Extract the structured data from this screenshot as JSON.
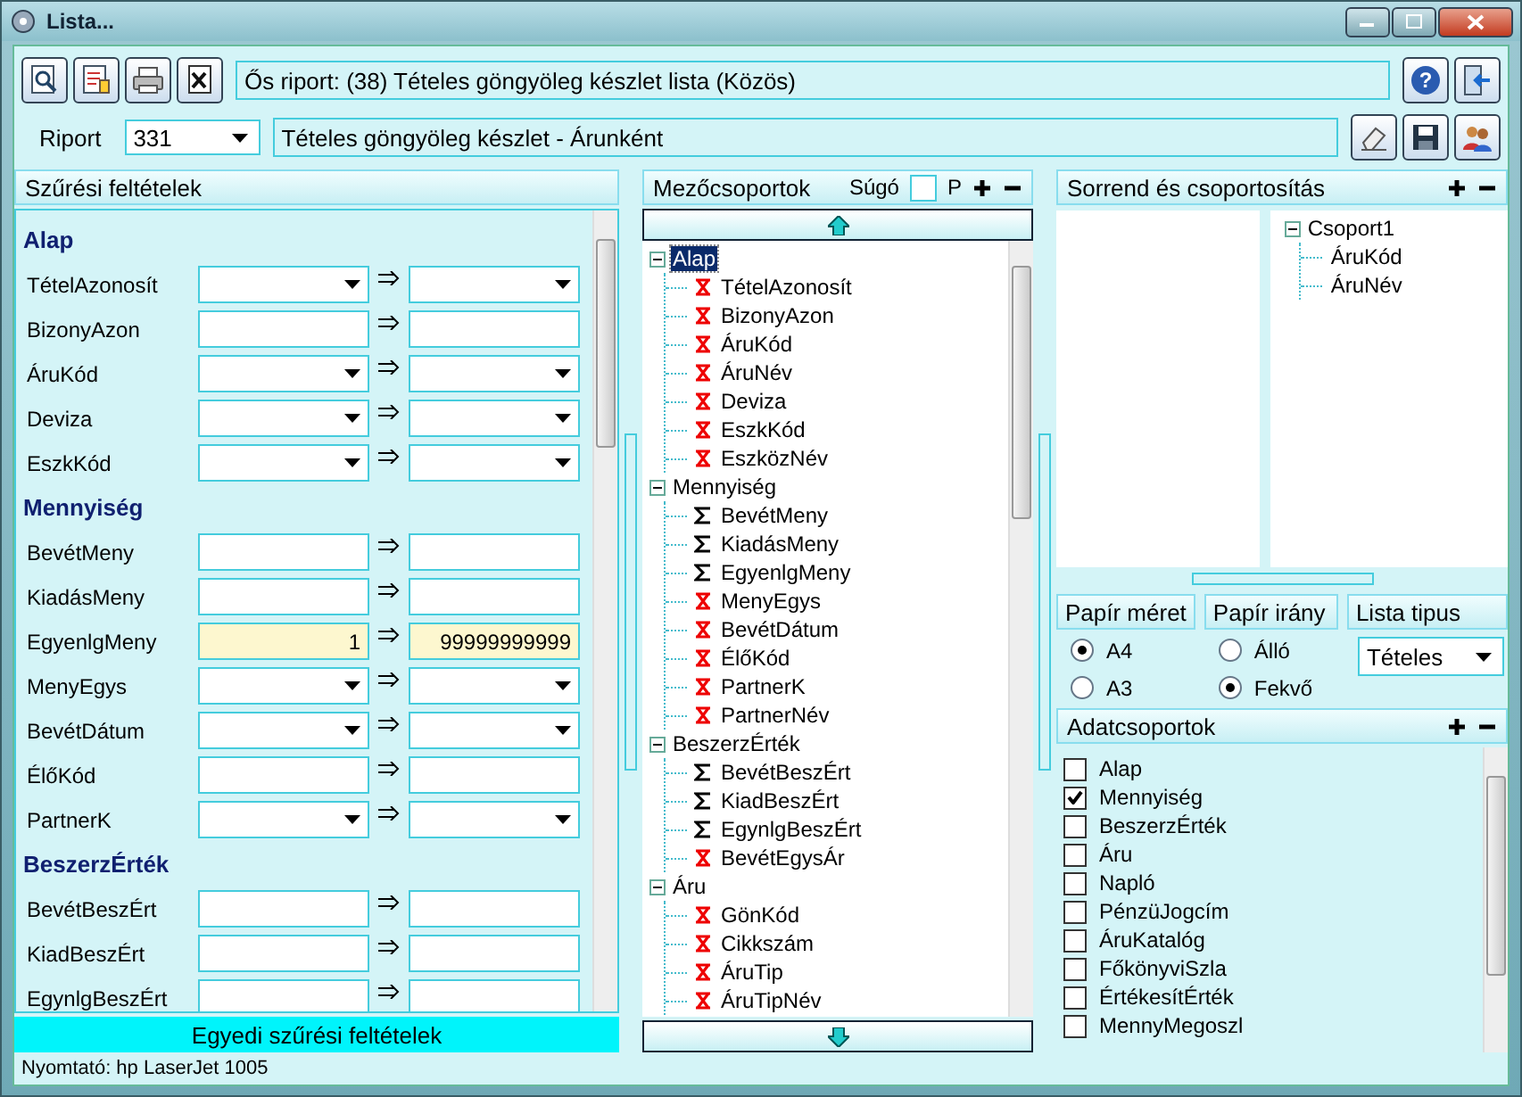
{
  "window": {
    "title": "Lista..."
  },
  "toolbar": {
    "help_button": "?",
    "parent_report": "Ős riport: (38)  Tételes göngyöleg készlet lista (Közös)"
  },
  "report": {
    "label": "Riport",
    "number": "331",
    "name": "Tételes göngyöleg készlet - Árunként"
  },
  "filters": {
    "title": "Szűrési feltételek",
    "groups": [
      {
        "name": "Alap",
        "rows": [
          {
            "label": "TételAzonosít",
            "kind": "combo",
            "highlighted": false
          },
          {
            "label": "BizonyAzon",
            "kind": "text",
            "highlighted": false
          },
          {
            "label": "ÁruKód",
            "kind": "combo",
            "highlighted": false
          },
          {
            "label": "Deviza",
            "kind": "combo",
            "highlighted": false
          },
          {
            "label": "EszkKód",
            "kind": "combo",
            "highlighted": false
          }
        ]
      },
      {
        "name": "Mennyiség",
        "rows": [
          {
            "label": "BevétMeny",
            "kind": "text",
            "highlighted": false
          },
          {
            "label": "KiadásMeny",
            "kind": "text",
            "highlighted": false
          },
          {
            "label": "EgyenlgMeny",
            "kind": "text",
            "highlighted": true,
            "from": "1",
            "to": "99999999999"
          },
          {
            "label": "MenyEgys",
            "kind": "combo",
            "highlighted": false
          },
          {
            "label": "BevétDátum",
            "kind": "combo",
            "highlighted": false
          },
          {
            "label": "ÉlőKód",
            "kind": "text",
            "highlighted": false
          },
          {
            "label": "PartnerK",
            "kind": "combo",
            "highlighted": false
          }
        ]
      },
      {
        "name": "BeszerzÉrték",
        "rows": [
          {
            "label": "BevétBeszÉrt",
            "kind": "text",
            "highlighted": false
          },
          {
            "label": "KiadBeszÉrt",
            "kind": "text",
            "highlighted": false
          },
          {
            "label": "EgynlgBeszÉrt",
            "kind": "text",
            "highlighted": false
          }
        ]
      }
    ],
    "custom_button": "Egyedi szűrési feltételek"
  },
  "field_groups": {
    "title": "Mezőcsoportok",
    "help_label": "Súgó",
    "help_checked": false,
    "p_label": "P",
    "tree": [
      {
        "label": "Alap",
        "selected": true,
        "expanded": true,
        "children": [
          {
            "label": "TételAzonosít",
            "kind": "x"
          },
          {
            "label": "BizonyAzon",
            "kind": "x"
          },
          {
            "label": "ÁruKód",
            "kind": "x"
          },
          {
            "label": "ÁruNév",
            "kind": "x"
          },
          {
            "label": "Deviza",
            "kind": "x"
          },
          {
            "label": "EszkKód",
            "kind": "x"
          },
          {
            "label": "EszközNév",
            "kind": "x"
          }
        ]
      },
      {
        "label": "Mennyiség",
        "selected": false,
        "expanded": true,
        "children": [
          {
            "label": "BevétMeny",
            "kind": "sum"
          },
          {
            "label": "KiadásMeny",
            "kind": "sum"
          },
          {
            "label": "EgyenlgMeny",
            "kind": "sum"
          },
          {
            "label": "MenyEgys",
            "kind": "x"
          },
          {
            "label": "BevétDátum",
            "kind": "x"
          },
          {
            "label": "ÉlőKód",
            "kind": "x"
          },
          {
            "label": "PartnerK",
            "kind": "x"
          },
          {
            "label": "PartnerNév",
            "kind": "x"
          }
        ]
      },
      {
        "label": "BeszerzÉrték",
        "selected": false,
        "expanded": true,
        "children": [
          {
            "label": "BevétBeszÉrt",
            "kind": "sum"
          },
          {
            "label": "KiadBeszÉrt",
            "kind": "sum"
          },
          {
            "label": "EgynlgBeszÉrt",
            "kind": "sum"
          },
          {
            "label": "BevétEgysÁr",
            "kind": "x"
          }
        ]
      },
      {
        "label": "Áru",
        "selected": false,
        "expanded": true,
        "children": [
          {
            "label": "GönKód",
            "kind": "x"
          },
          {
            "label": "Cikkszám",
            "kind": "x"
          },
          {
            "label": "ÁruTip",
            "kind": "x"
          },
          {
            "label": "ÁruTipNév",
            "kind": "x"
          }
        ]
      }
    ]
  },
  "sorting": {
    "title": "Sorrend és csoportosítás",
    "groups": [
      {
        "label": "Csoport1",
        "expanded": true,
        "children": [
          {
            "label": "ÁruKód"
          },
          {
            "label": "ÁruNév"
          }
        ]
      }
    ]
  },
  "paper_size": {
    "title": "Papír méret",
    "options": [
      {
        "label": "A4",
        "selected": true
      },
      {
        "label": "A3",
        "selected": false
      }
    ]
  },
  "paper_orientation": {
    "title": "Papír irány",
    "options": [
      {
        "label": "Álló",
        "selected": false
      },
      {
        "label": "Fekvő",
        "selected": true
      }
    ]
  },
  "list_type": {
    "title": "Lista tipus",
    "value": "Tételes"
  },
  "data_groups": {
    "title": "Adatcsoportok",
    "items": [
      {
        "label": "Alap",
        "checked": false
      },
      {
        "label": "Mennyiség",
        "checked": true
      },
      {
        "label": "BeszerzÉrték",
        "checked": false
      },
      {
        "label": "Áru",
        "checked": false
      },
      {
        "label": "Napló",
        "checked": false
      },
      {
        "label": "PénzüJogcím",
        "checked": false
      },
      {
        "label": "ÁruKatalóg",
        "checked": false
      },
      {
        "label": "FőkönyviSzla",
        "checked": false
      },
      {
        "label": "ÉrtékesítÉrték",
        "checked": false
      },
      {
        "label": "MennyMegoszl",
        "checked": false
      }
    ]
  },
  "status_bar": {
    "printer": "Nyomtató: hp LaserJet 1005"
  }
}
